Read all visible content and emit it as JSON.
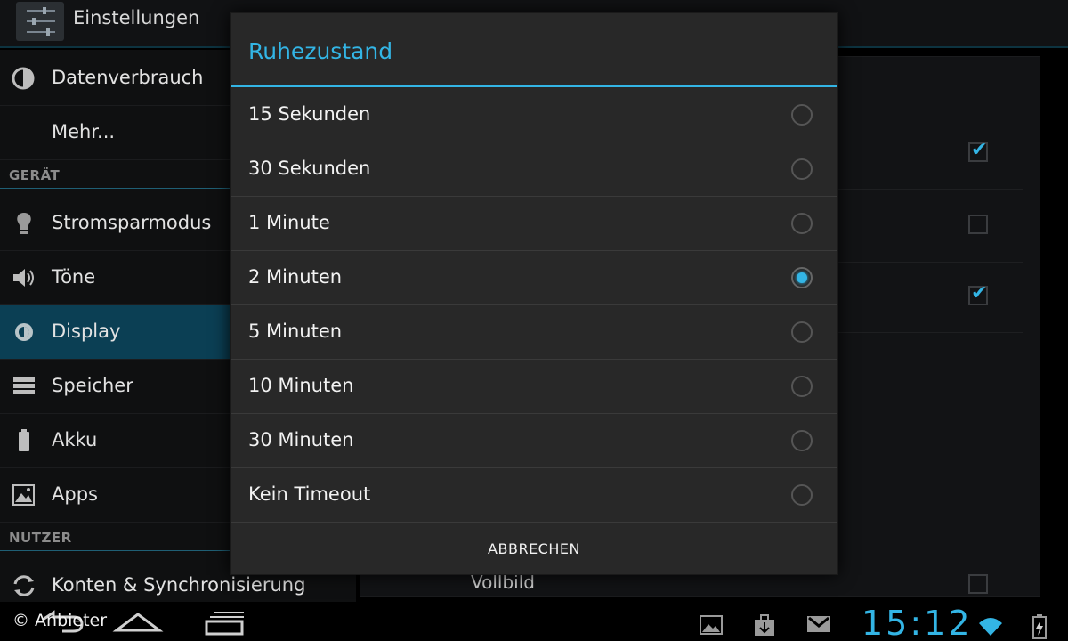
{
  "actionbar": {
    "title": "Einstellungen",
    "icon": "settings-sliders-icon"
  },
  "settings": {
    "items_top": [
      {
        "label": "Datenverbrauch",
        "icon": "data-usage-icon"
      },
      {
        "label": "Mehr...",
        "icon": ""
      }
    ],
    "section_device": "GERÄT",
    "items_device": [
      {
        "label": "Stromsparmodus",
        "icon": "bulb-icon"
      },
      {
        "label": "Töne",
        "icon": "speaker-icon"
      },
      {
        "label": "Display",
        "icon": "brightness-icon",
        "active": true
      },
      {
        "label": "Speicher",
        "icon": "storage-icon"
      },
      {
        "label": "Akku",
        "icon": "battery-icon"
      },
      {
        "label": "Apps",
        "icon": "apps-icon"
      }
    ],
    "section_user": "NUTZER",
    "items_user": [
      {
        "label": "Konten & Synchronisierung",
        "icon": "sync-icon"
      }
    ]
  },
  "detail": {
    "checkboxes": [
      {
        "checked": true
      },
      {
        "checked": false
      },
      {
        "checked": true
      },
      {
        "checked": false
      }
    ],
    "last_label": "Vollbild"
  },
  "dialog": {
    "title": "Ruhezustand",
    "options": [
      {
        "label": "15 Sekunden",
        "selected": false
      },
      {
        "label": "30 Sekunden",
        "selected": false
      },
      {
        "label": "1 Minute",
        "selected": false
      },
      {
        "label": "2 Minuten",
        "selected": true
      },
      {
        "label": "5 Minuten",
        "selected": false
      },
      {
        "label": "10 Minuten",
        "selected": false
      },
      {
        "label": "30 Minuten",
        "selected": false
      },
      {
        "label": "Kein Timeout",
        "selected": false
      }
    ],
    "cancel_label": "ABBRECHEN"
  },
  "systembar": {
    "credit": "© Anbieter",
    "clock": "15:12",
    "icons": [
      "back-icon",
      "home-icon",
      "recent-apps-icon",
      "gallery-icon",
      "download-icon",
      "gmail-icon",
      "wifi-icon",
      "battery-charging-icon"
    ]
  },
  "colors": {
    "accent": "#33b5e5",
    "active_item": "#0b3f54",
    "dialog_bg": "#282828"
  }
}
